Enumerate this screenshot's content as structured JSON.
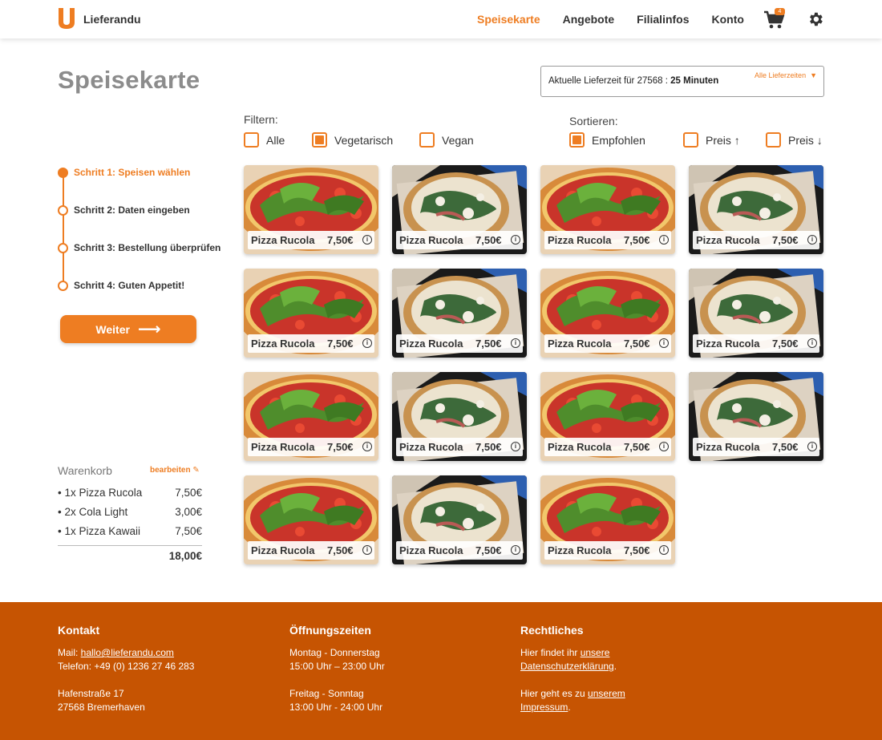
{
  "header": {
    "brand": "Lieferandu",
    "nav": [
      {
        "label": "Speisekarte",
        "active": true
      },
      {
        "label": "Angebote",
        "active": false
      },
      {
        "label": "Filialinfos",
        "active": false
      },
      {
        "label": "Konto",
        "active": false
      }
    ],
    "cart_badge": "4",
    "icons": {
      "cart": "cart-icon",
      "settings": "gear-icon"
    },
    "accent_color": "#ee7d22"
  },
  "page": {
    "title": "Speisekarte"
  },
  "delivery": {
    "prefix": "Aktuelle Lieferzeit für 27568 : ",
    "time": "25 Minuten",
    "all_link": "Alle Lieferzeiten"
  },
  "filters": {
    "label": "Filtern:",
    "options": [
      {
        "label": "Alle",
        "checked": false
      },
      {
        "label": "Vegetarisch",
        "checked": true
      },
      {
        "label": "Vegan",
        "checked": false
      }
    ]
  },
  "sort": {
    "label": "Sortieren:",
    "options": [
      {
        "label": "Empfohlen",
        "checked": true
      },
      {
        "label": "Preis ↑",
        "checked": false
      },
      {
        "label": "Preis ↓",
        "checked": false
      }
    ]
  },
  "steps": [
    {
      "label": "Schritt 1: Speisen wählen",
      "active": true
    },
    {
      "label": "Schritt 2: Daten eingeben",
      "active": false
    },
    {
      "label": "Schritt 3: Bestellung überprüfen",
      "active": false
    },
    {
      "label": "Schritt 4: Guten Appetit!",
      "active": false
    }
  ],
  "weiter_button": "Weiter",
  "cart": {
    "title": "Warenkorb",
    "edit_label": "bearbeiten",
    "items": [
      {
        "name": "• 1x Pizza Rucola",
        "price": "7,50€"
      },
      {
        "name": "• 2x Cola Light",
        "price": "3,00€"
      },
      {
        "name": "• 1x Pizza Kawaii",
        "price": "7,50€"
      }
    ],
    "total": "18,00€"
  },
  "products": [
    {
      "name": "Pizza Rucola",
      "price": "7,50€",
      "image": "pizza-rucola-photo"
    },
    {
      "name": "Pizza Rucola",
      "price": "7,50€",
      "image": "pizza-photo-alt"
    },
    {
      "name": "Pizza Rucola",
      "price": "7,50€",
      "image": "pizza-rucola-photo"
    },
    {
      "name": "Pizza Rucola",
      "price": "7,50€",
      "image": "pizza-photo-alt"
    },
    {
      "name": "Pizza Rucola",
      "price": "7,50€",
      "image": "pizza-rucola-photo"
    },
    {
      "name": "Pizza Rucola",
      "price": "7,50€",
      "image": "pizza-photo-alt"
    },
    {
      "name": "Pizza Rucola",
      "price": "7,50€",
      "image": "pizza-rucola-photo"
    },
    {
      "name": "Pizza Rucola",
      "price": "7,50€",
      "image": "pizza-photo-alt"
    },
    {
      "name": "Pizza Rucola",
      "price": "7,50€",
      "image": "pizza-rucola-photo"
    },
    {
      "name": "Pizza Rucola",
      "price": "7,50€",
      "image": "pizza-photo-alt"
    },
    {
      "name": "Pizza Rucola",
      "price": "7,50€",
      "image": "pizza-rucola-photo"
    },
    {
      "name": "Pizza Rucola",
      "price": "7,50€",
      "image": "pizza-photo-alt"
    },
    {
      "name": "Pizza Rucola",
      "price": "7,50€",
      "image": "pizza-rucola-photo"
    },
    {
      "name": "Pizza Rucola",
      "price": "7,50€",
      "image": "pizza-photo-alt"
    },
    {
      "name": "Pizza Rucola",
      "price": "7,50€",
      "image": "pizza-rucola-photo"
    }
  ],
  "footer": {
    "bg_color": "#c65402",
    "kontakt": {
      "title": "Kontakt",
      "mail_label": "Mail: ",
      "mail": "hallo@lieferandu.com",
      "phone": "Telefon: +49 (0) 1236 27 46 283",
      "street": "Hafenstraße 17",
      "city": "27568 Bremerhaven"
    },
    "hours": {
      "title": "Öffnungszeiten",
      "weekdays": "Montag - Donnerstag",
      "weekdays_time": "15:00 Uhr – 23:00 Uhr",
      "weekend": "Freitag - Sonntag",
      "weekend_time": "13:00 Uhr - 24:00 Uhr"
    },
    "legal": {
      "title": "Rechtliches",
      "privacy_prefix": "Hier findet ihr ",
      "privacy_link_1": "unsere",
      "privacy_link_2": "Datenschutzerklärung",
      "imprint_prefix": "Hier geht es zu ",
      "imprint_link_1": "unserem",
      "imprint_link_2": "Impressum"
    }
  }
}
